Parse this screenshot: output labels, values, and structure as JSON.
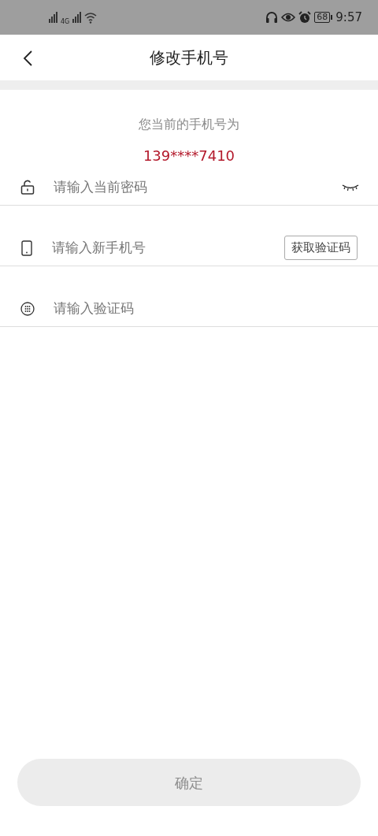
{
  "status_bar": {
    "network": "4G",
    "battery": "68",
    "time": "9:57"
  },
  "header": {
    "title": "修改手机号"
  },
  "current_phone": {
    "label": "您当前的手机号为",
    "number": "139****7410"
  },
  "fields": [
    {
      "kind": "password",
      "placeholder": "请输入当前密码",
      "password_visible": false
    },
    {
      "kind": "phone",
      "placeholder": "请输入新手机号",
      "button": "获取验证码"
    },
    {
      "kind": "code",
      "placeholder": "请输入验证码"
    }
  ],
  "confirm_button": {
    "label": "确定",
    "disabled": true
  }
}
